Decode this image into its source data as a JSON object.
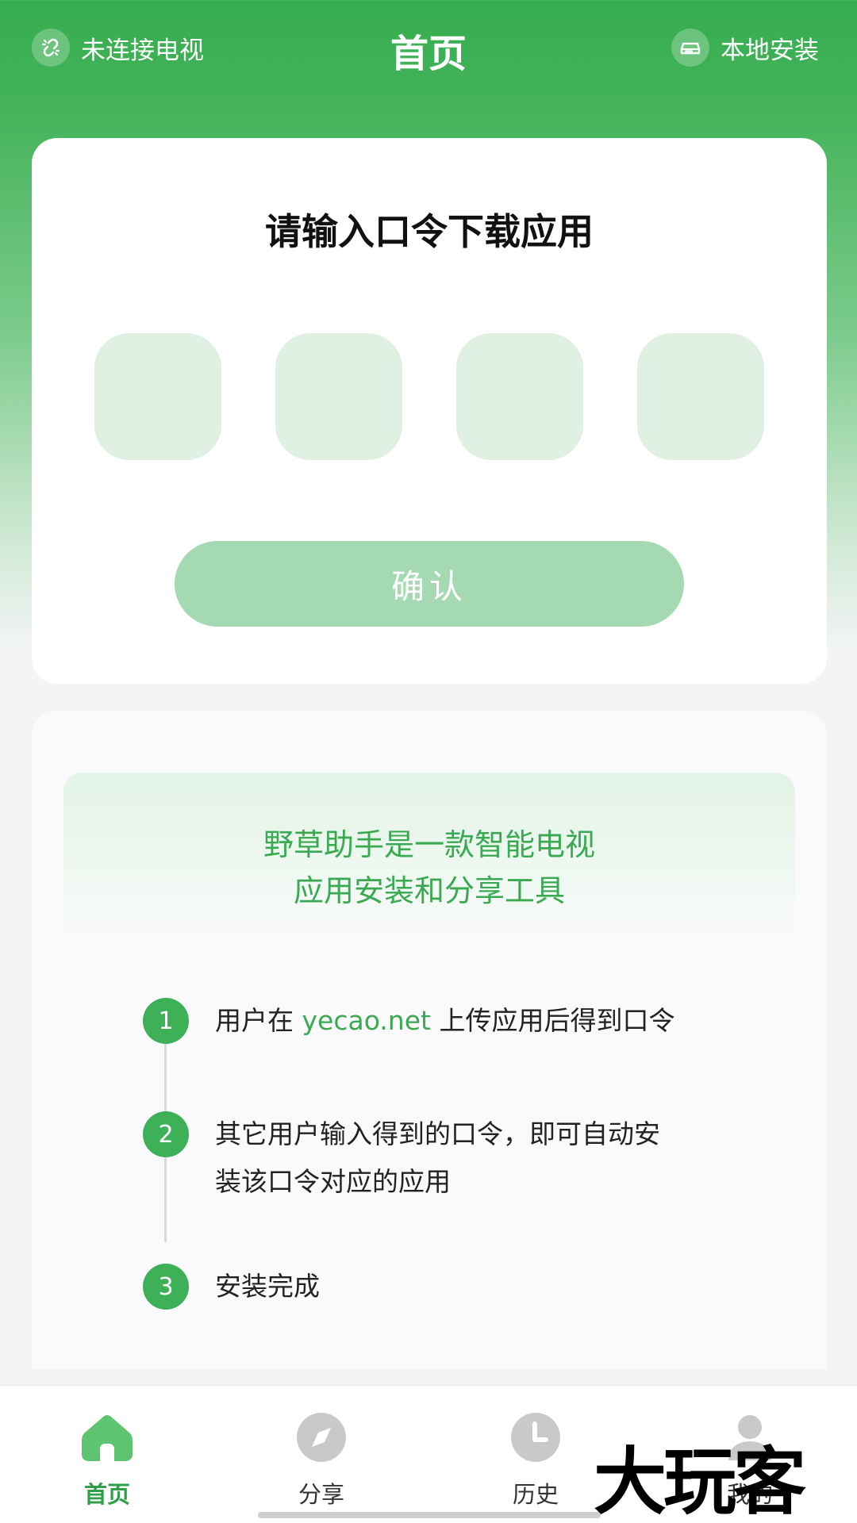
{
  "header": {
    "tv_status": "未连接电视",
    "title": "首页",
    "local_install": "本地安装"
  },
  "code_card": {
    "title": "请输入口令下载应用",
    "code_slots": [
      "",
      "",
      "",
      ""
    ],
    "confirm_label": "确认"
  },
  "intro": {
    "banner_line1": "野草助手是一款智能电视",
    "banner_line2": "应用安装和分享工具",
    "steps": [
      {
        "num": "1",
        "text_before": "用户在 ",
        "link": "yecao.net",
        "text_after": " 上传应用后得到口令"
      },
      {
        "num": "2",
        "line1": "其它用户输入得到的口令，即可自动安",
        "line2": "装该口令对应的应用"
      },
      {
        "num": "3",
        "text": "安装完成"
      }
    ]
  },
  "tabbar": {
    "items": [
      {
        "label": "首页",
        "icon": "home-icon",
        "active": true
      },
      {
        "label": "分享",
        "icon": "compass-icon",
        "active": false
      },
      {
        "label": "历史",
        "icon": "clock-icon",
        "active": false
      },
      {
        "label": "我的",
        "icon": "user-icon",
        "active": false
      }
    ]
  },
  "watermark": "大玩客",
  "colors": {
    "brand_green": "#35ad4e",
    "code_box": "#e0f1e4",
    "confirm_disabled": "#a4d9b1",
    "link_green": "#3aaa52"
  }
}
